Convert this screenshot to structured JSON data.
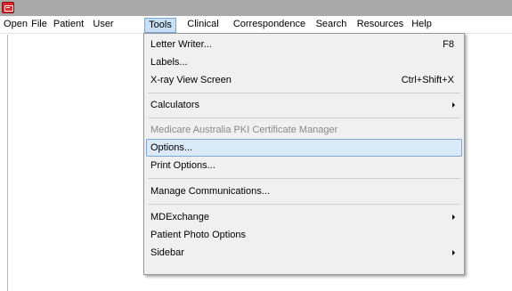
{
  "menubar": {
    "items": [
      {
        "id": "open",
        "label": "Open"
      },
      {
        "id": "file",
        "label": "File"
      },
      {
        "id": "patient",
        "label": "Patient"
      },
      {
        "id": "user",
        "label": "User"
      },
      {
        "id": "tools",
        "label": "Tools"
      },
      {
        "id": "clinical",
        "label": "Clinical"
      },
      {
        "id": "correspondence",
        "label": "Correspondence"
      },
      {
        "id": "search",
        "label": "Search"
      },
      {
        "id": "resources",
        "label": "Resources"
      },
      {
        "id": "help",
        "label": "Help"
      }
    ]
  },
  "tools_menu": {
    "items": [
      {
        "label": "Letter Writer...",
        "shortcut": "F8"
      },
      {
        "label": "Labels..."
      },
      {
        "label": "X-ray View Screen",
        "shortcut": "Ctrl+Shift+X"
      },
      {
        "label": "Calculators",
        "submenu": true
      },
      {
        "label": "Medicare Australia PKI Certificate Manager",
        "disabled": true
      },
      {
        "label": "Options...",
        "highlighted": true
      },
      {
        "label": "Print Options..."
      },
      {
        "label": "Manage Communications..."
      },
      {
        "label": "MDExchange",
        "submenu": true
      },
      {
        "label": "Patient Photo Options"
      },
      {
        "label": "Sidebar",
        "submenu": true
      }
    ]
  },
  "colors": {
    "titlebar": "#aaaaaa",
    "menu_background": "#f0f0f0",
    "highlight": "#dbeaf9",
    "highlight_border": "#7aa6d8",
    "disabled_text": "#8a8a8a",
    "app_icon": "#d92b2b"
  },
  "icons": {
    "app": "app-icon",
    "submenu": "chevron-right-icon"
  }
}
